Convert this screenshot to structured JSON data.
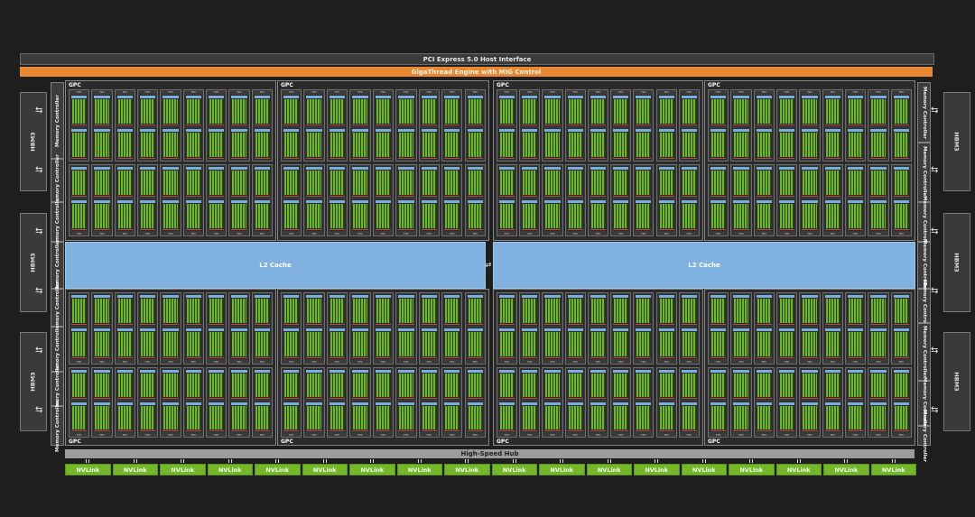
{
  "pcie": {
    "label": "PCI Express 5.0 Host Interface"
  },
  "gigathread": {
    "label": "GigaThread Engine with MIG Control"
  },
  "l2": {
    "label": "L2 Cache"
  },
  "hub": {
    "label": "High-Speed Hub"
  },
  "hbm_label": "HBM3",
  "memory_controller_label": "Memory Controller",
  "gpc_label": "GPC",
  "tpc_label": "TPC",
  "sm_label": "SM",
  "nvlink_label": "NVLink",
  "nvlink_count": 18,
  "colors": {
    "background": "#1e1e1e",
    "gigathread": "#e88835",
    "l2_cache": "#7fb2df",
    "nvlink": "#74b72a",
    "sm_cores": "#6fb431",
    "hub": "#9c9c9c"
  }
}
